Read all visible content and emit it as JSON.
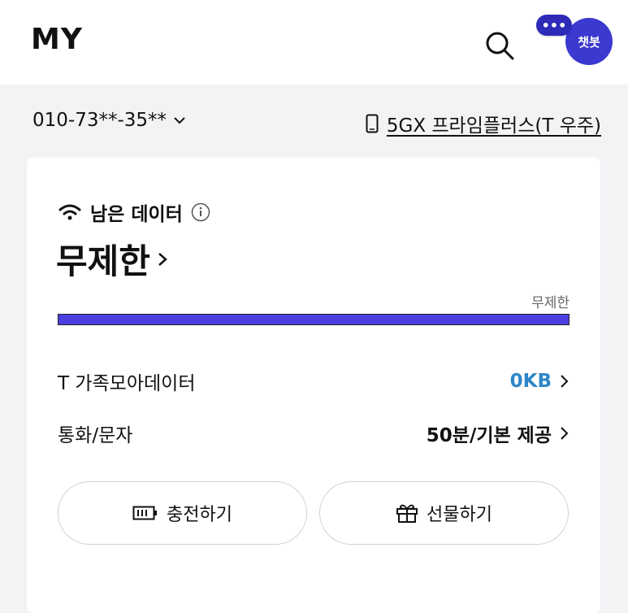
{
  "header": {
    "title": "MY",
    "chatbot_label": "챗봇",
    "chat_bubble": "•••"
  },
  "line": {
    "phone": "010-73**-35**",
    "plan": "5GX 프라임플러스(T 우주)"
  },
  "data_card": {
    "label": "남은 데이터",
    "value": "무제한",
    "bar_label": "무제한",
    "bar_fill_fraction": 1.0,
    "family_label": "T 가족모아데이터",
    "family_value": "0KB",
    "call_label": "통화/문자",
    "call_value": "50분/기본 제공",
    "charge_label": "충전하기",
    "gift_label": "선물하기"
  },
  "colors": {
    "accent": "#4b3fe0",
    "chatbot": "#3b39d0",
    "family_value": "#2e86c8"
  }
}
